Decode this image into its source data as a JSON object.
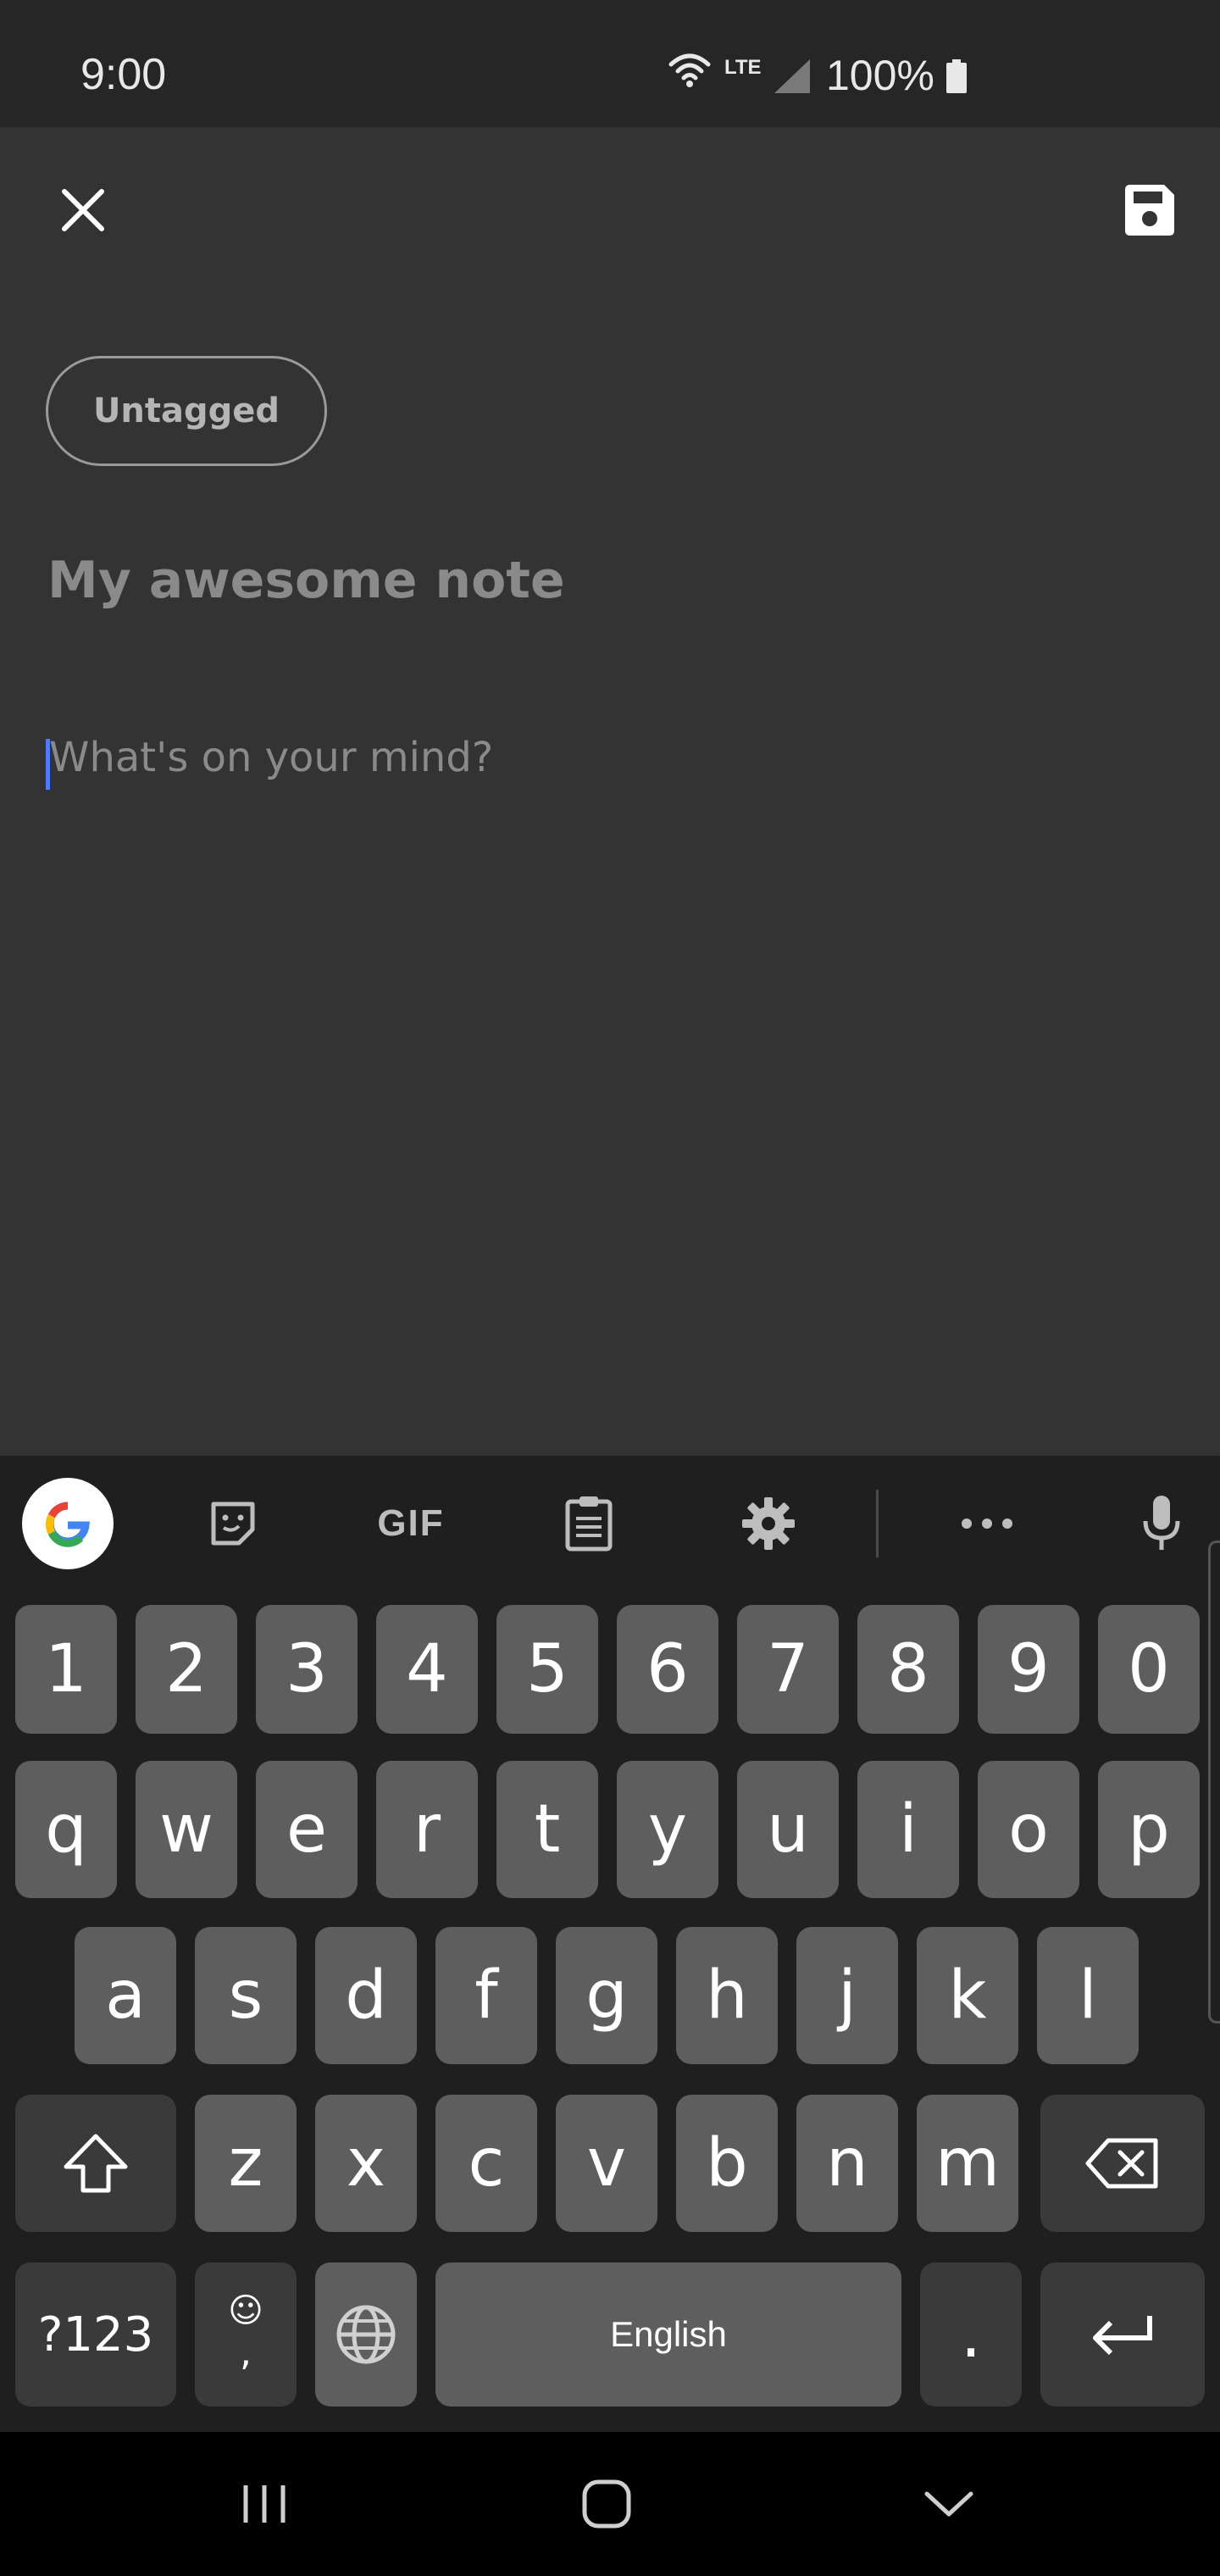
{
  "status_bar": {
    "time": "9:00",
    "network": "LTE",
    "battery": "100%",
    "icons": [
      "wifi-icon",
      "signal-icon",
      "battery-icon"
    ]
  },
  "app_bar": {
    "close_icon": "close-icon",
    "save_icon": "save-icon"
  },
  "note": {
    "tag": "Untagged",
    "title_placeholder": "My awesome note",
    "body_placeholder": "What's on your mind?"
  },
  "keyboard": {
    "toolbar": [
      "google-icon",
      "sticker-icon",
      "GIF",
      "clipboard-icon",
      "gear-icon",
      "more-icon",
      "mic-icon"
    ],
    "gif_label": "GIF",
    "row_numbers": [
      "1",
      "2",
      "3",
      "4",
      "5",
      "6",
      "7",
      "8",
      "9",
      "0"
    ],
    "row1": [
      "q",
      "w",
      "e",
      "r",
      "t",
      "y",
      "u",
      "i",
      "o",
      "p"
    ],
    "row2": [
      "a",
      "s",
      "d",
      "f",
      "g",
      "h",
      "j",
      "k",
      "l"
    ],
    "row3": [
      "z",
      "x",
      "c",
      "v",
      "b",
      "n",
      "m"
    ],
    "symbols_label": "?123",
    "comma_label": ",",
    "space_label": "English",
    "period_label": ".",
    "accent_color": "#4d7cff"
  },
  "nav_bar": {
    "buttons": [
      "recents-icon",
      "home-icon",
      "back-icon"
    ]
  }
}
